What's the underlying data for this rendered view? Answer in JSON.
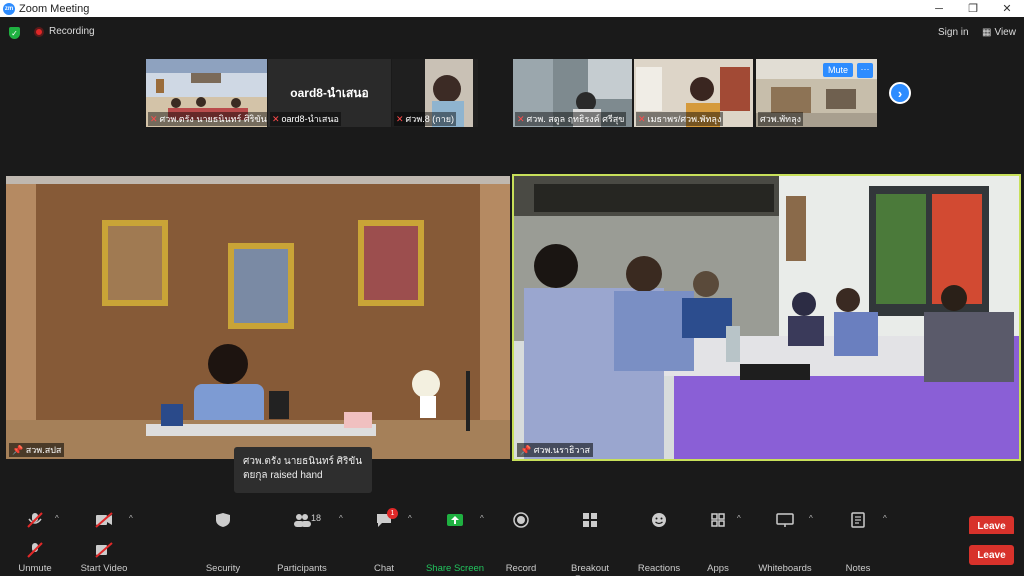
{
  "window": {
    "title": "Zoom Meeting"
  },
  "topbar": {
    "recording": "Recording",
    "sign_in": "Sign in",
    "view": "View"
  },
  "thumbnails": [
    {
      "label": "ศวพ.ตรัง นายธนินทร์ ศิริขัน..."
    },
    {
      "label": "oard8-นำเสนอ",
      "name": "oard8-นำเสนอ"
    },
    {
      "label": "ศวพ.8 (กาย)"
    },
    {
      "label": "ศวพ. สตูล ฤทธิรงค์ ศรีสุข"
    },
    {
      "label": "เมธาพร/ศวพ.พัทลุง"
    },
    {
      "label": "ศวพ.พัทลุง"
    }
  ],
  "thumb_controls": {
    "mute": "Mute",
    "more": "···"
  },
  "videos": {
    "left_label": "สวพ.สปส",
    "right_label": "ศวพ.นราธิวาส"
  },
  "tooltip": {
    "text": "ศวพ.ตรัง นายธนินทร์ ศิริขันตยกุล raised hand"
  },
  "toolbar": {
    "unmute": "Unmute",
    "start_video": "Start Video",
    "security": "Security",
    "participants": "Participants",
    "participants_count": "18",
    "chat": "Chat",
    "chat_badge": "1",
    "share_screen": "Share Screen",
    "record": "Record",
    "breakout_rooms": "Breakout Rooms",
    "reactions": "Reactions",
    "apps": "Apps",
    "whiteboards": "Whiteboards",
    "notes": "Notes",
    "leave": "Leave"
  },
  "colors": {
    "accent": "#2d8cff",
    "leave": "#d8322b",
    "share": "#1fb141",
    "speaker_border": "#c8e05a"
  }
}
